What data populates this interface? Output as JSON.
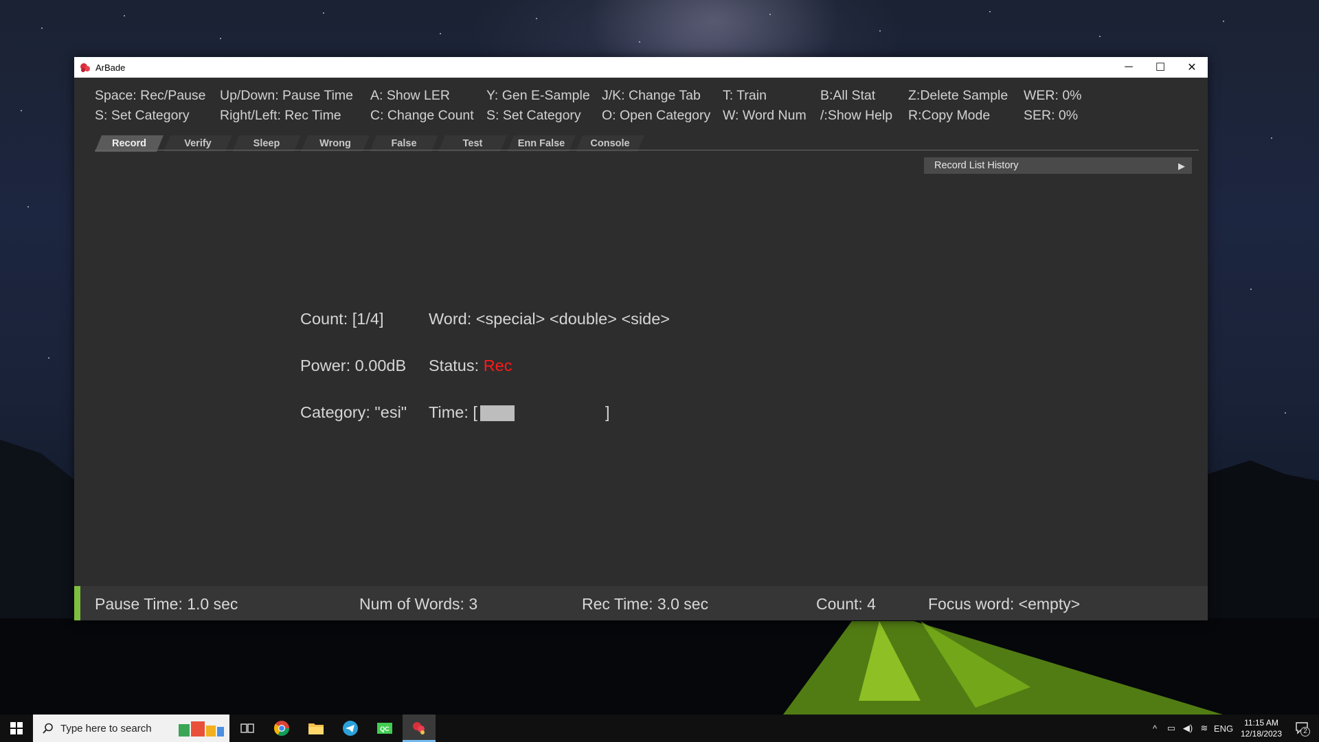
{
  "window": {
    "title": "ArBade",
    "controls": {
      "minimize": "─",
      "maximize": "☐",
      "close": "✕"
    }
  },
  "shortcuts": [
    [
      "Space: Rec/Pause",
      "S: Set Category"
    ],
    [
      "Up/Down: Pause Time",
      "Right/Left: Rec Time"
    ],
    [
      "A: Show LER",
      "C: Change Count"
    ],
    [
      "Y: Gen E-Sample",
      "S: Set Category"
    ],
    [
      "J/K: Change Tab",
      "O: Open Category"
    ],
    [
      "T: Train",
      "W: Word Num"
    ],
    [
      "B:All Stat",
      "/:Show Help"
    ],
    [
      "Z:Delete Sample",
      "R:Copy Mode"
    ],
    [
      "WER: 0%",
      "SER:  0%"
    ]
  ],
  "tabs": [
    "Record",
    "Verify",
    "Sleep",
    "Wrong",
    "False",
    "Test",
    "Enn False",
    "Console"
  ],
  "active_tab": "Record",
  "history": {
    "label": "Record List History",
    "arrow": "▶"
  },
  "record": {
    "count": "Count: [1/4]",
    "word": "Word: <special> <double> <side>",
    "power": "Power: 0.00dB",
    "status_label": "Status: ",
    "status_value": "Rec",
    "category": "Category: \"esi\"",
    "time_open": "Time: [",
    "time_close": "]",
    "time_progress": 0.3
  },
  "statusbar": {
    "pause_time": "Pause Time: 1.0 sec",
    "num_words": "Num of Words: 3",
    "rec_time": "Rec Time: 3.0 sec",
    "count": "Count: 4",
    "focus_word": "Focus word: <empty>"
  },
  "taskbar": {
    "search_placeholder": "Type here to search",
    "tray_lang": "ENG",
    "time": "11:15 AM",
    "date": "12/18/2023",
    "notifications": "2"
  },
  "colors": {
    "window_bg": "#2d2d2d",
    "status_rec": "#ff1a1a",
    "accent_green": "#7fbf3f",
    "taskbar_bg": "#101010"
  }
}
